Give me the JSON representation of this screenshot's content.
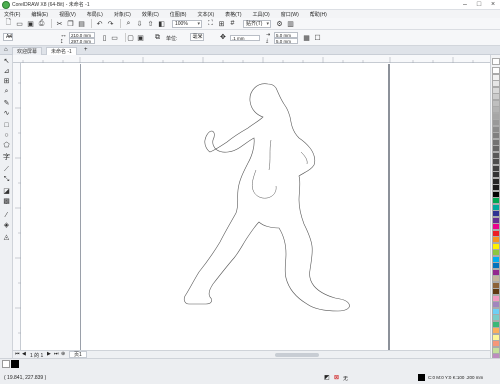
{
  "window": {
    "title": "CorelDRAW X8 (64-Bit) - 未命名 -1"
  },
  "menu": [
    "文件(F)",
    "编辑(E)",
    "视图(V)",
    "布局(L)",
    "对象(C)",
    "效果(C)",
    "位图(B)",
    "文本(X)",
    "表格(T)",
    "工具(O)",
    "窗口(W)",
    "帮助(H)"
  ],
  "toolbar": {
    "zoom_value": "100%",
    "snap_label": "贴齐(T)"
  },
  "propbar": {
    "page_size": "A4",
    "width": "210.0 mm",
    "height": "297.0 mm",
    "units_label": "单位:",
    "units_value": "毫米",
    "nudge": ".1 mm",
    "dup_x": "5.0 mm",
    "dup_y": "5.0 mm"
  },
  "tabs": [
    {
      "label": "欢迎屏幕"
    },
    {
      "label": "未命名 -1"
    }
  ],
  "docnav": {
    "page_info": "1 的 1",
    "page_tab": "页1"
  },
  "status": {
    "coords": "( 19.841, 227.839 )",
    "fill_info": "C:0 M:0 Y:0 K:100 .200 mm",
    "outline_none": "无"
  },
  "palette_colors": [
    "#ffffff",
    "#f2f2f2",
    "#e6e6e6",
    "#d9d9d9",
    "#cccccc",
    "#bfbfbf",
    "#b3b3b3",
    "#a6a6a6",
    "#999999",
    "#8c8c8c",
    "#808080",
    "#737373",
    "#666666",
    "#595959",
    "#4d4d4d",
    "#404040",
    "#333333",
    "#262626",
    "#1a1a1a",
    "#000000",
    "#00a651",
    "#00a99d",
    "#2e3192",
    "#662d91",
    "#ec008c",
    "#ed1c24",
    "#f7941d",
    "#fff200",
    "#8dc63f",
    "#00aeef",
    "#0072bc",
    "#92278f",
    "#c2b59b",
    "#8c6239",
    "#603913",
    "#f49ac2",
    "#a186be",
    "#6dcff6",
    "#7accc8",
    "#3cb878",
    "#fbaf5d",
    "#fff799",
    "#f69679",
    "#c4df9b",
    "#bd8cbf"
  ]
}
